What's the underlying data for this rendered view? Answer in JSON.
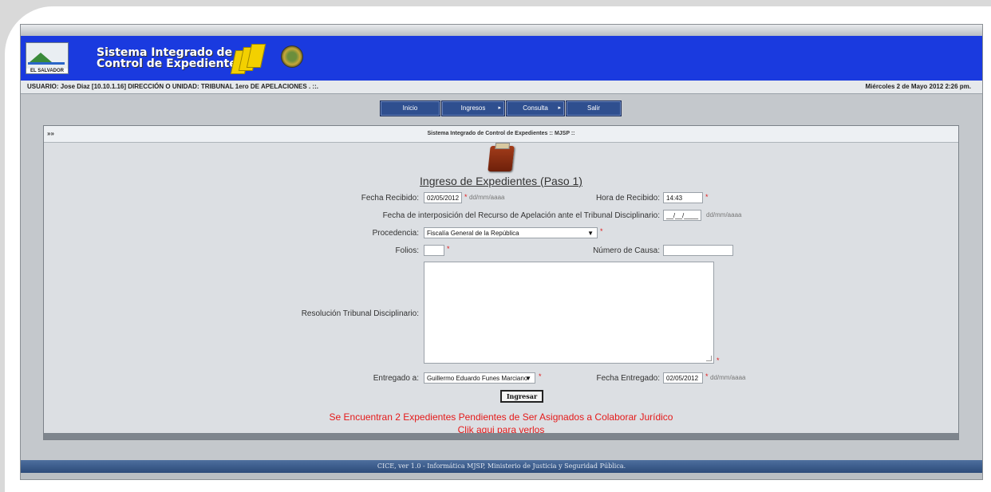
{
  "header": {
    "logo_text": "EL SALVADOR",
    "app_title_line1": "Sistema Integrado de",
    "app_title_line2": "Control de Expedientes"
  },
  "infobar": {
    "user_info": "USUARIO: Jose Diaz [10.10.1.16]   DIRECCIÓN O UNIDAD: TRIBUNAL 1ero DE APELACIONES . ::.",
    "datetime": "Miércoles 2 de Mayo 2012 2:26 pm."
  },
  "menu": {
    "inicio": "Inicio",
    "ingresos": "Ingresos",
    "consulta": "Consulta",
    "salir": "Salir",
    "submenu_arrow": "▸"
  },
  "panel": {
    "header_prefix": "»»",
    "header_text": "Sistema Integrado de Control de Expedientes  :: MJSP ::"
  },
  "form": {
    "title": "Ingreso de Expedientes (Paso 1)",
    "fecha_recibido_label": "Fecha Recibido:",
    "fecha_recibido_value": "02/05/2012",
    "date_hint": "dd/mm/aaaa",
    "required_mark": "*",
    "hora_recibido_label": "Hora de Recibido:",
    "hora_recibido_value": "14:43",
    "fecha_interposicion_label": "Fecha de interposición del Recurso de Apelación ante el Tribunal Disciplinario:",
    "fecha_interposicion_placeholder": "__/__/____",
    "procedencia_label": "Procedencia:",
    "procedencia_value": "Fiscalía General de la República",
    "folios_label": "Folios:",
    "folios_value": "",
    "numero_causa_label": "Número de Causa:",
    "numero_causa_value": "",
    "resolucion_label": "Resolución Tribunal Disciplinario:",
    "entregado_label": "Entregado a:",
    "entregado_value": "Guillermo Eduardo Funes Marciano",
    "fecha_entregado_label": "Fecha Entregado:",
    "fecha_entregado_value": "02/05/2012",
    "submit_label": "Ingresar",
    "caret": "▼"
  },
  "notice": {
    "line1": "Se Encuentran 2 Expedientes Pendientes de Ser Asignados a Colaborar Jurídico",
    "line2_pre": "Clik ",
    "link": "aqui",
    "line2_post": " para verlos"
  },
  "footer": {
    "text": "CICE, ver 1.0 - Informática MJSP, Ministerio de Justicia y Seguridad Pública."
  },
  "colors": {
    "banner_blue": "#1a3adf",
    "menu_blue": "#2f4f8f",
    "required_red": "#e01a1a",
    "footer_blue": "#3a5a8a"
  }
}
